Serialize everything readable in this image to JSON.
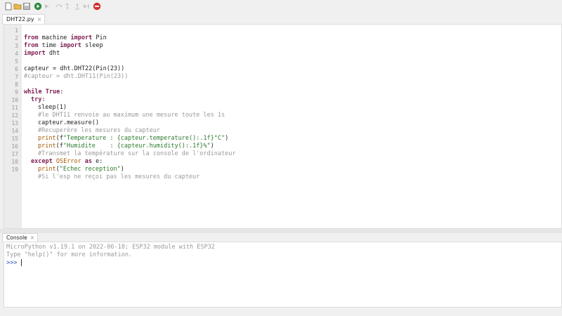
{
  "toolbar": {
    "icons": [
      "new-file",
      "open-file",
      "save",
      "run",
      "debug",
      "step-over",
      "step-into",
      "step-out",
      "resume",
      "stop"
    ]
  },
  "editor": {
    "tab_label": "DHT22.py",
    "tab_close": "×",
    "lines": [
      {
        "n": "1"
      },
      {
        "n": "2"
      },
      {
        "n": "3"
      },
      {
        "n": "4"
      },
      {
        "n": "5"
      },
      {
        "n": "6"
      },
      {
        "n": "7"
      },
      {
        "n": "8"
      },
      {
        "n": "9"
      },
      {
        "n": "10"
      },
      {
        "n": "11"
      },
      {
        "n": "12"
      },
      {
        "n": "13"
      },
      {
        "n": "14"
      },
      {
        "n": "15"
      },
      {
        "n": "16"
      },
      {
        "n": "17"
      },
      {
        "n": "18"
      },
      {
        "n": "19"
      }
    ],
    "code": {
      "l1_kw1": "from",
      "l1_mid": " machine ",
      "l1_kw2": "import",
      "l1_end": " Pin",
      "l2_kw1": "from",
      "l2_mid": " time ",
      "l2_kw2": "import",
      "l2_end": " sleep",
      "l3_kw1": "import",
      "l3_end": " dht",
      "l5": "capteur = dht.DHT22(Pin(23))",
      "l6": "#capteur = dht.DHT11(Pin(23))",
      "l8_kw": "while",
      "l8_sp": " ",
      "l8_kw2": "True",
      "l8_end": ":",
      "l9_kw": "try",
      "l9_end": ":",
      "l10": "sleep(1)",
      "l11": "#le DHT11 renvoie au maximum une mesure toute les 1s",
      "l12": "capteur.measure()",
      "l13": "#Recuperère les mesures du capteur",
      "l14_bi": "print",
      "l14_a": "(f",
      "l14_str": "\"Temperature : {capteur.temperature():.1f}°C\"",
      "l14_end": ")",
      "l15_bi": "print",
      "l15_a": "(f",
      "l15_str": "\"Humidite    : {capteur.humidity():.1f}%\"",
      "l15_end": ")",
      "l16": "#Transmet la température sur la console de l'ordinateur",
      "l17_kw": "except",
      "l17_bi": " OSError ",
      "l17_kw2": "as",
      "l17_end": " e:",
      "l18_bi": "print",
      "l18_a": "(",
      "l18_str": "\"Echec reception\"",
      "l18_end": ")",
      "l19": "#Si l'esp ne reçoi pas les mesures du capteur"
    }
  },
  "console": {
    "tab_label": "Console",
    "tab_close": "×",
    "line1": "MicroPython v1.19.1 on 2022-06-18; ESP32 module with ESP32",
    "line2": "Type \"help()\" for more information.",
    "prompt": ">>>"
  },
  "colors": {
    "keyword": "#7b1c50",
    "string": "#2b7a2b",
    "comment": "#9a9a9a",
    "builtin": "#a65a00",
    "run_button": "#2e8b3d",
    "stop_button": "#d32f2f"
  }
}
